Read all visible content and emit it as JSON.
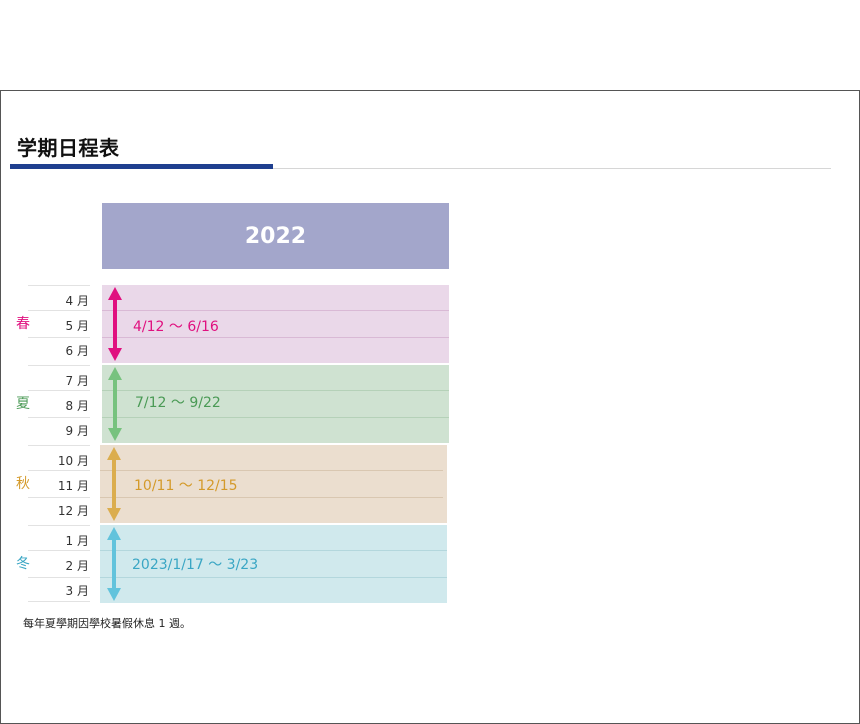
{
  "page": {
    "title": "学期日程表",
    "year": "2022",
    "note": "每年夏學期因學校暑假休息 1 週。"
  },
  "seasons": [
    {
      "label": "春",
      "months": [
        "4 月",
        "5 月",
        "6 月"
      ],
      "range": "4/12 ～ 6/16",
      "label_color": "#e0107f",
      "band_color": "#ead8e9",
      "line_color": "#d9b9d5",
      "arrow_color": "#e0107f"
    },
    {
      "label": "夏",
      "months": [
        "7 月",
        "8 月",
        "9 月"
      ],
      "range": "7/12 ～ 9/22",
      "label_color": "#4a9a55",
      "band_color": "#cfe2d1",
      "line_color": "#b5d1b8",
      "arrow_color": "#77c27e"
    },
    {
      "label": "秋",
      "months": [
        "10 月",
        "11 月",
        "12 月"
      ],
      "range": "10/11 ～ 12/15",
      "label_color": "#d49a2a",
      "band_color": "#ebdecf",
      "line_color": "#d9c7b1",
      "arrow_color": "#dbad4e"
    },
    {
      "label": "冬",
      "months": [
        "1 月",
        "2 月",
        "3 月"
      ],
      "range": "2023/1/17 ～ 3/23",
      "label_color": "#3aa6c4",
      "band_color": "#d0e9ed",
      "line_color": "#b3d7dd",
      "arrow_color": "#62c3dc"
    }
  ]
}
